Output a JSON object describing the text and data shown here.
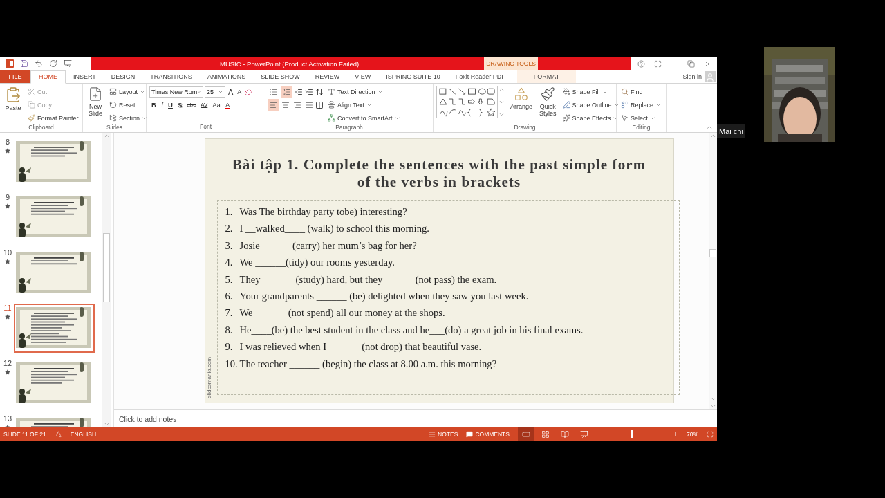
{
  "title_bar": {
    "title": "MUSIC -  PowerPoint (Product Activation Failed)",
    "contextual_tab": "DRAWING TOOLS"
  },
  "tabs": [
    {
      "label": "FILE",
      "kind": "file",
      "selected": false
    },
    {
      "label": "HOME",
      "kind": "tab",
      "selected": true
    },
    {
      "label": "INSERT",
      "kind": "tab",
      "selected": false
    },
    {
      "label": "DESIGN",
      "kind": "tab",
      "selected": false
    },
    {
      "label": "TRANSITIONS",
      "kind": "tab",
      "selected": false
    },
    {
      "label": "ANIMATIONS",
      "kind": "tab",
      "selected": false
    },
    {
      "label": "SLIDE SHOW",
      "kind": "tab",
      "selected": false
    },
    {
      "label": "REVIEW",
      "kind": "tab",
      "selected": false
    },
    {
      "label": "VIEW",
      "kind": "tab",
      "selected": false
    },
    {
      "label": "ISPRING SUITE 10",
      "kind": "tab",
      "selected": false
    },
    {
      "label": "Foxit Reader PDF",
      "kind": "tab",
      "selected": false
    },
    {
      "label": "FORMAT",
      "kind": "contextual",
      "selected": false
    }
  ],
  "sign_in": "Sign in",
  "clipboard": {
    "label": "Clipboard",
    "paste": "Paste",
    "cut": "Cut",
    "copy": "Copy",
    "format_painter": "Format Painter"
  },
  "slides_group": {
    "label": "Slides",
    "new_slide": "New Slide",
    "layout": "Layout",
    "reset": "Reset",
    "section": "Section"
  },
  "font": {
    "label": "Font",
    "font_name": "Times New Rom",
    "font_size": "25",
    "size_buttons": [
      "A",
      "A"
    ],
    "format_buttons": [
      "B",
      "I",
      "U",
      "S",
      "abc",
      "AV",
      "Aa",
      "A"
    ]
  },
  "paragraph": {
    "label": "Paragraph",
    "list_buttons": [
      {
        "kind": "bullets",
        "selected": false
      },
      {
        "kind": "numbering",
        "selected": true
      }
    ],
    "align_buttons": [
      {
        "kind": "left",
        "selected": true
      },
      {
        "kind": "center",
        "selected": false
      },
      {
        "kind": "right",
        "selected": false
      },
      {
        "kind": "justify",
        "selected": false
      }
    ],
    "text_direction": "Text Direction",
    "align_text": "Align Text",
    "convert_smartart": "Convert to SmartArt"
  },
  "drawing": {
    "label": "Drawing",
    "arrange": "Arrange",
    "quick_styles": "Quick Styles",
    "shape_fill": "Shape Fill",
    "shape_outline": "Shape Outline",
    "shape_effects": "Shape Effects"
  },
  "editing": {
    "label": "Editing",
    "find": "Find",
    "replace": "Replace",
    "select": "Select"
  },
  "thumbnails": [
    {
      "number": "8",
      "selected": false
    },
    {
      "number": "9",
      "selected": false
    },
    {
      "number": "10",
      "selected": false
    },
    {
      "number": "11",
      "selected": true
    },
    {
      "number": "12",
      "selected": false
    },
    {
      "number": "13",
      "selected": false
    }
  ],
  "slide": {
    "title": "Bài tập 1. Complete the sentences with the past simple form of the verbs in brackets",
    "items": [
      {
        "number": "1.",
        "text": "Was The birthday party tobe) interesting?"
      },
      {
        "number": "2.",
        "text": "I __walked____ (walk) to school this morning."
      },
      {
        "number": "3.",
        "text": "Josie ______(carry) her mum’s bag for her?"
      },
      {
        "number": "4.",
        "text": "We ______(tidy) our rooms yesterday."
      },
      {
        "number": "5.",
        "text": "They ______ (study) hard, but they ______(not pass) the exam."
      },
      {
        "number": "6.",
        "text": "Your grandparents ______ (be) delighted when they saw you last week."
      },
      {
        "number": "7.",
        "text": "We ______ (not spend) all our money at the shops."
      },
      {
        "number": "8.",
        "text": "He____(be) the best student in the class and he___(do) a great job in his final exams."
      },
      {
        "number": "9.",
        "text": "I was relieved when I ______ (not drop) that beautiful vase."
      },
      {
        "number": "10.",
        "text": "The teacher ______ (begin) the class at 8.00 a.m. this morning?"
      }
    ],
    "side_credit": "slidesmania.com"
  },
  "notes_placeholder": "Click to add notes",
  "status_bar": {
    "slide": "SLIDE 11 OF 21",
    "language": "ENGLISH",
    "notes": "NOTES",
    "comments": "COMMENTS",
    "views": [
      {
        "kind": "normal",
        "selected": true
      },
      {
        "kind": "sorter",
        "selected": false
      },
      {
        "kind": "reading",
        "selected": false
      },
      {
        "kind": "slideshow",
        "selected": false
      }
    ],
    "zoom": {
      "level": 0.34,
      "reading": "70%"
    }
  },
  "video": {
    "name": "Mai chi"
  }
}
